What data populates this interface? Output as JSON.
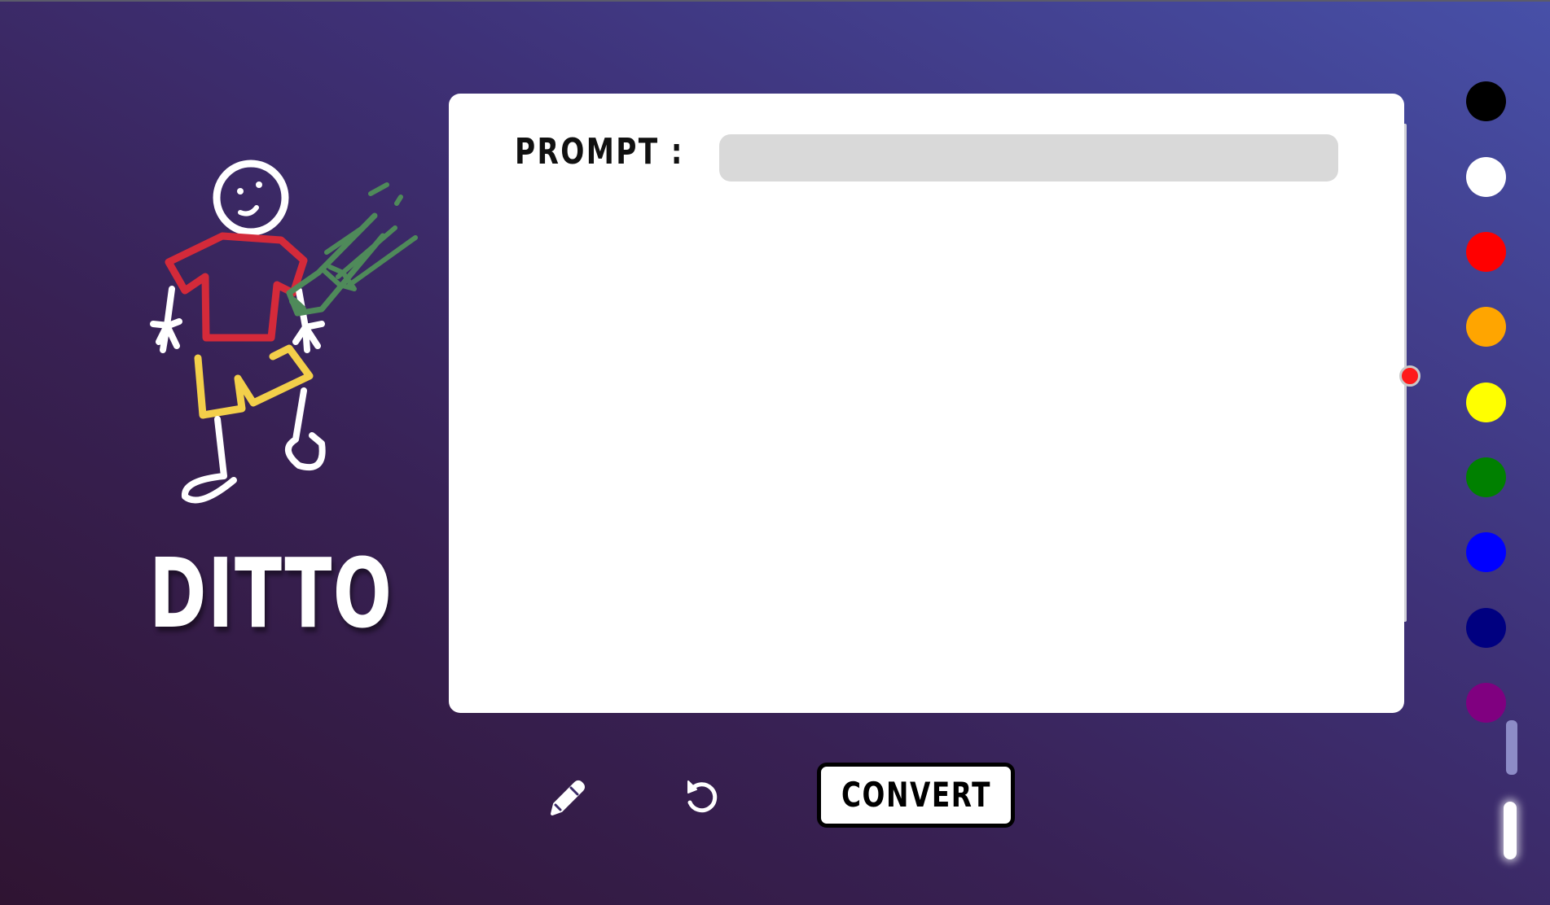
{
  "app": {
    "brand_name": "DITTO"
  },
  "prompt": {
    "label": "PROMPT :",
    "value": "",
    "placeholder": ""
  },
  "toolbar": {
    "pencil_icon": "pencil-icon",
    "undo_icon": "undo-icon",
    "convert_label": "CONVERT"
  },
  "brush": {
    "current_color": "#ff1a1a"
  },
  "palette": {
    "colors": [
      "#000000",
      "#ffffff",
      "#ff0000",
      "#ffa500",
      "#ffff00",
      "#008000",
      "#0000ff",
      "#000080",
      "#800080"
    ]
  },
  "colors": {
    "background_start": "#2f1432",
    "background_end": "#4750a8",
    "canvas": "#ffffff",
    "prompt_field": "#d9d9d9"
  }
}
